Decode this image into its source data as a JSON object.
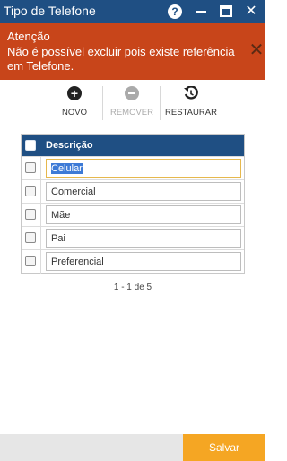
{
  "window": {
    "title": "Tipo de Telefone",
    "help_glyph": "?",
    "close_glyph": "✕"
  },
  "alert": {
    "title": "Atenção",
    "message": "Não é possível excluir pois existe referência em Telefone.",
    "close_glyph": "✕",
    "color": "#c8451a"
  },
  "toolbar": {
    "new_label": "NOVO",
    "remove_label": "REMOVER",
    "restore_label": "RESTAURAR"
  },
  "grid": {
    "column_header": "Descrição",
    "rows": [
      {
        "value": "Celular"
      },
      {
        "value": "Comercial"
      },
      {
        "value": "Mãe"
      },
      {
        "value": "Pai"
      },
      {
        "value": "Preferencial"
      }
    ]
  },
  "pager": {
    "text": "1 - 1 de 5"
  },
  "footer": {
    "save_label": "Salvar"
  },
  "colors": {
    "primary": "#1f4f83",
    "accent": "#f5a623",
    "alert": "#c8451a"
  }
}
